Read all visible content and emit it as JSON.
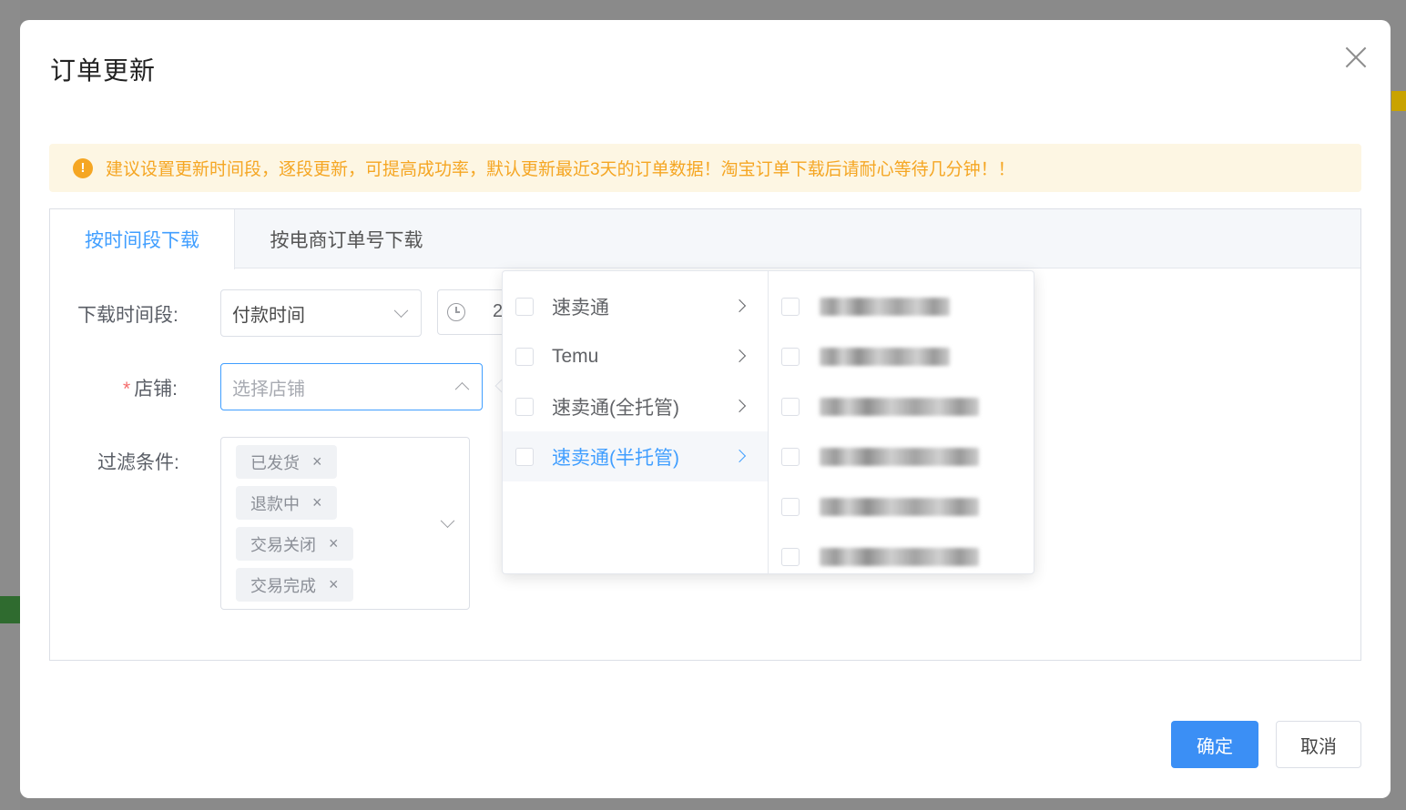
{
  "dialog": {
    "title": "订单更新",
    "close_icon": "close-icon"
  },
  "alert": {
    "icon": "warning-icon",
    "icon_glyph": "!",
    "text": "建议设置更新时间段，逐段更新，可提高成功率，默认更新最近3天的订单数据！淘宝订单下载后请耐心等待几分钟！！"
  },
  "tabs": [
    {
      "label": "按时间段下载",
      "active": true
    },
    {
      "label": "按电商订单号下载",
      "active": false
    }
  ],
  "form": {
    "time_range": {
      "label": "下载时间段:",
      "value": "付款时间",
      "date_prefix": "2"
    },
    "shop": {
      "required_mark": "*",
      "label": "店铺:",
      "placeholder": "选择店铺"
    },
    "filter": {
      "label": "过滤条件:",
      "tags": [
        "已发货",
        "退款中",
        "交易关闭",
        "交易完成"
      ],
      "remove_glyph": "×"
    }
  },
  "cascader": {
    "platforms": [
      {
        "label": "速卖通",
        "highlighted": false
      },
      {
        "label": "Temu",
        "highlighted": false
      },
      {
        "label": "速卖通(全托管)",
        "highlighted": false
      },
      {
        "label": "速卖通(半托管)",
        "highlighted": true
      }
    ],
    "shop_count": 6
  },
  "footer": {
    "confirm": "确定",
    "cancel": "取消"
  },
  "colors": {
    "primary": "#409eff",
    "warning": "#f5a623",
    "warning_bg": "#fdf6e3",
    "danger": "#f56c6c"
  }
}
